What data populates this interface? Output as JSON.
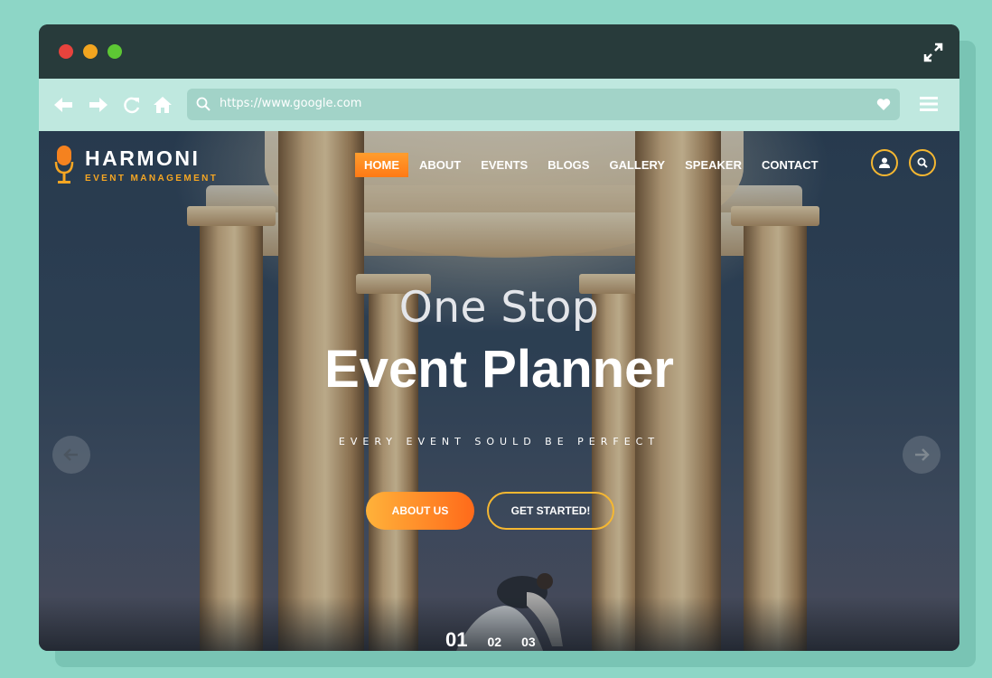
{
  "browser": {
    "url": "https://www.google.com"
  },
  "site": {
    "logo": {
      "name": "HARMONI",
      "tagline": "EVENT MANAGEMENT"
    },
    "nav": [
      {
        "label": "HOME",
        "active": true
      },
      {
        "label": "ABOUT",
        "active": false
      },
      {
        "label": "EVENTS",
        "active": false
      },
      {
        "label": "BLOGS",
        "active": false
      },
      {
        "label": "GALLERY",
        "active": false
      },
      {
        "label": "SPEAKER",
        "active": false
      },
      {
        "label": "CONTACT",
        "active": false
      }
    ],
    "hero": {
      "subtitle": "One Stop",
      "title": "Event Planner",
      "tagline": "EVERY EVENT SOULD BE PERFECT",
      "primary_button": "ABOUT US",
      "secondary_button": "GET STARTED!"
    },
    "slides": [
      "01",
      "02",
      "03"
    ]
  },
  "colors": {
    "accent_orange": "#ff7a15",
    "accent_yellow": "#f5b731",
    "titlebar": "#283b3b",
    "toolbar": "#bfe8df",
    "page_bg": "#8dd6c6"
  },
  "icons": [
    "back-arrow-icon",
    "forward-arrow-icon",
    "reload-icon",
    "home-icon",
    "search-icon",
    "heart-icon",
    "hamburger-menu-icon",
    "expand-icon",
    "microphone-logo-icon",
    "user-icon",
    "arrow-left-icon",
    "arrow-right-icon"
  ]
}
